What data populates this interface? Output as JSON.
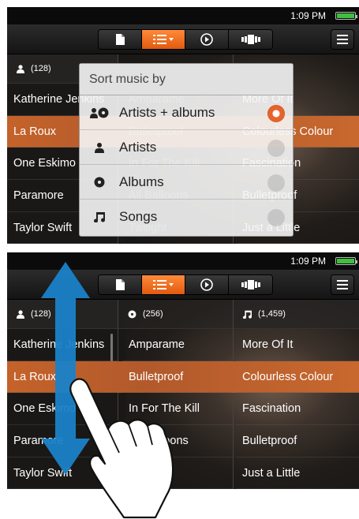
{
  "status": {
    "time": "1:09 PM"
  },
  "tabs": [
    {
      "icon": "file-icon"
    },
    {
      "icon": "list-view-icon",
      "active": true
    },
    {
      "icon": "play-icon"
    },
    {
      "icon": "cover-flow-icon"
    }
  ],
  "menu_icon": "menu-icon",
  "columns": {
    "artists": {
      "count": "(128)",
      "items": [
        "Katherine Jenkins",
        "La Roux",
        "One Eskimo",
        "Paramore",
        "Taylor Swift"
      ]
    },
    "albums": {
      "count": "(256)",
      "items": [
        "Amparame",
        "Bulletproof",
        "In For The Kill",
        "All Balloons",
        "Twilight"
      ]
    },
    "songs": {
      "count": "(1,459)",
      "items": [
        "More Of It",
        "Colourless Colour",
        "Fascination",
        "Bulletproof",
        "Just a Little"
      ]
    }
  },
  "selected_row": 1,
  "sort_popup": {
    "title": "Sort music by",
    "options": [
      {
        "label": "Artists + albums",
        "icon": "artist-album-icon",
        "selected": true
      },
      {
        "label": "Artists",
        "icon": "person-icon",
        "selected": false
      },
      {
        "label": "Albums",
        "icon": "disc-icon",
        "selected": false
      },
      {
        "label": "Songs",
        "icon": "music-note-icon",
        "selected": false
      }
    ]
  },
  "colors": {
    "accent": "#e8632a",
    "arrow": "#1a82c8"
  }
}
